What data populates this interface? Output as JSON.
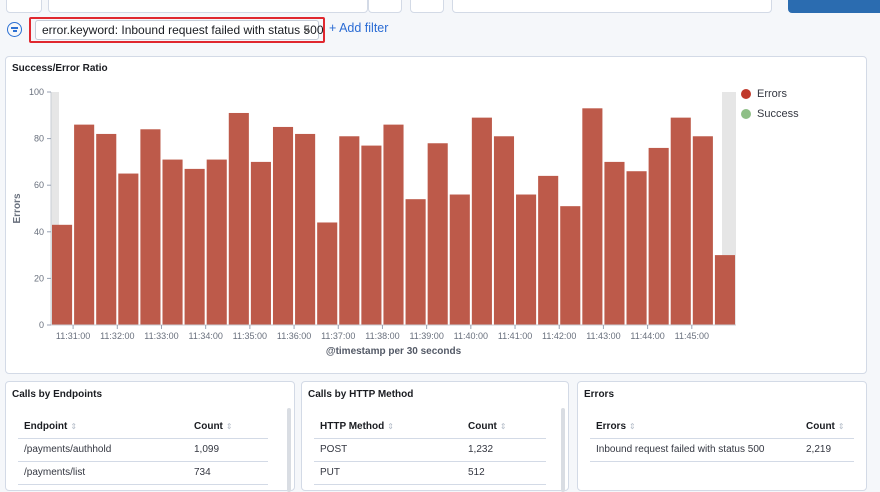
{
  "filter": {
    "text": "error.keyword: Inbound request failed with status 500",
    "remove_label": "×",
    "add_filter_label": "+ Add filter"
  },
  "chart_panel": {
    "title": "Success/Error Ratio"
  },
  "chart_data": {
    "type": "bar",
    "ylabel": "Errors",
    "xlabel": "@timestamp per 30 seconds",
    "ylim": [
      0,
      100
    ],
    "yticks": [
      0,
      20,
      40,
      60,
      80,
      100
    ],
    "x_tick_labels": [
      "11:31:00",
      "11:32:00",
      "11:33:00",
      "11:34:00",
      "11:35:00",
      "11:36:00",
      "11:37:00",
      "11:38:00",
      "11:39:00",
      "11:40:00",
      "11:41:00",
      "11:42:00",
      "11:43:00",
      "11:44:00",
      "11:45:00"
    ],
    "series": [
      {
        "name": "Errors",
        "color": "#bd5a4a",
        "values": [
          43,
          86,
          82,
          65,
          84,
          71,
          67,
          71,
          91,
          70,
          85,
          82,
          44,
          81,
          77,
          86,
          54,
          78,
          56,
          89,
          81,
          56,
          64,
          51,
          93,
          70,
          66,
          76,
          89,
          81,
          30
        ]
      },
      {
        "name": "Success",
        "color": "#8ebf86",
        "values": []
      }
    ],
    "legend_position": "top-right",
    "grid": false
  },
  "tables": [
    {
      "title": "Calls by Endpoints",
      "columns": [
        "Endpoint",
        "Count"
      ],
      "rows": [
        [
          "/payments/authhold",
          "1,099"
        ],
        [
          "/payments/list",
          "734"
        ]
      ]
    },
    {
      "title": "Calls by HTTP Method",
      "columns": [
        "HTTP Method",
        "Count"
      ],
      "rows": [
        [
          "POST",
          "1,232"
        ],
        [
          "PUT",
          "512"
        ]
      ]
    },
    {
      "title": "Errors",
      "columns": [
        "Errors",
        "Count"
      ],
      "rows": [
        [
          "Inbound request failed with status 500",
          "2,219"
        ]
      ]
    }
  ],
  "icons": {
    "filter": "filter-options-icon",
    "sort": "sort-icon",
    "legend": "legend-dot-icon"
  }
}
